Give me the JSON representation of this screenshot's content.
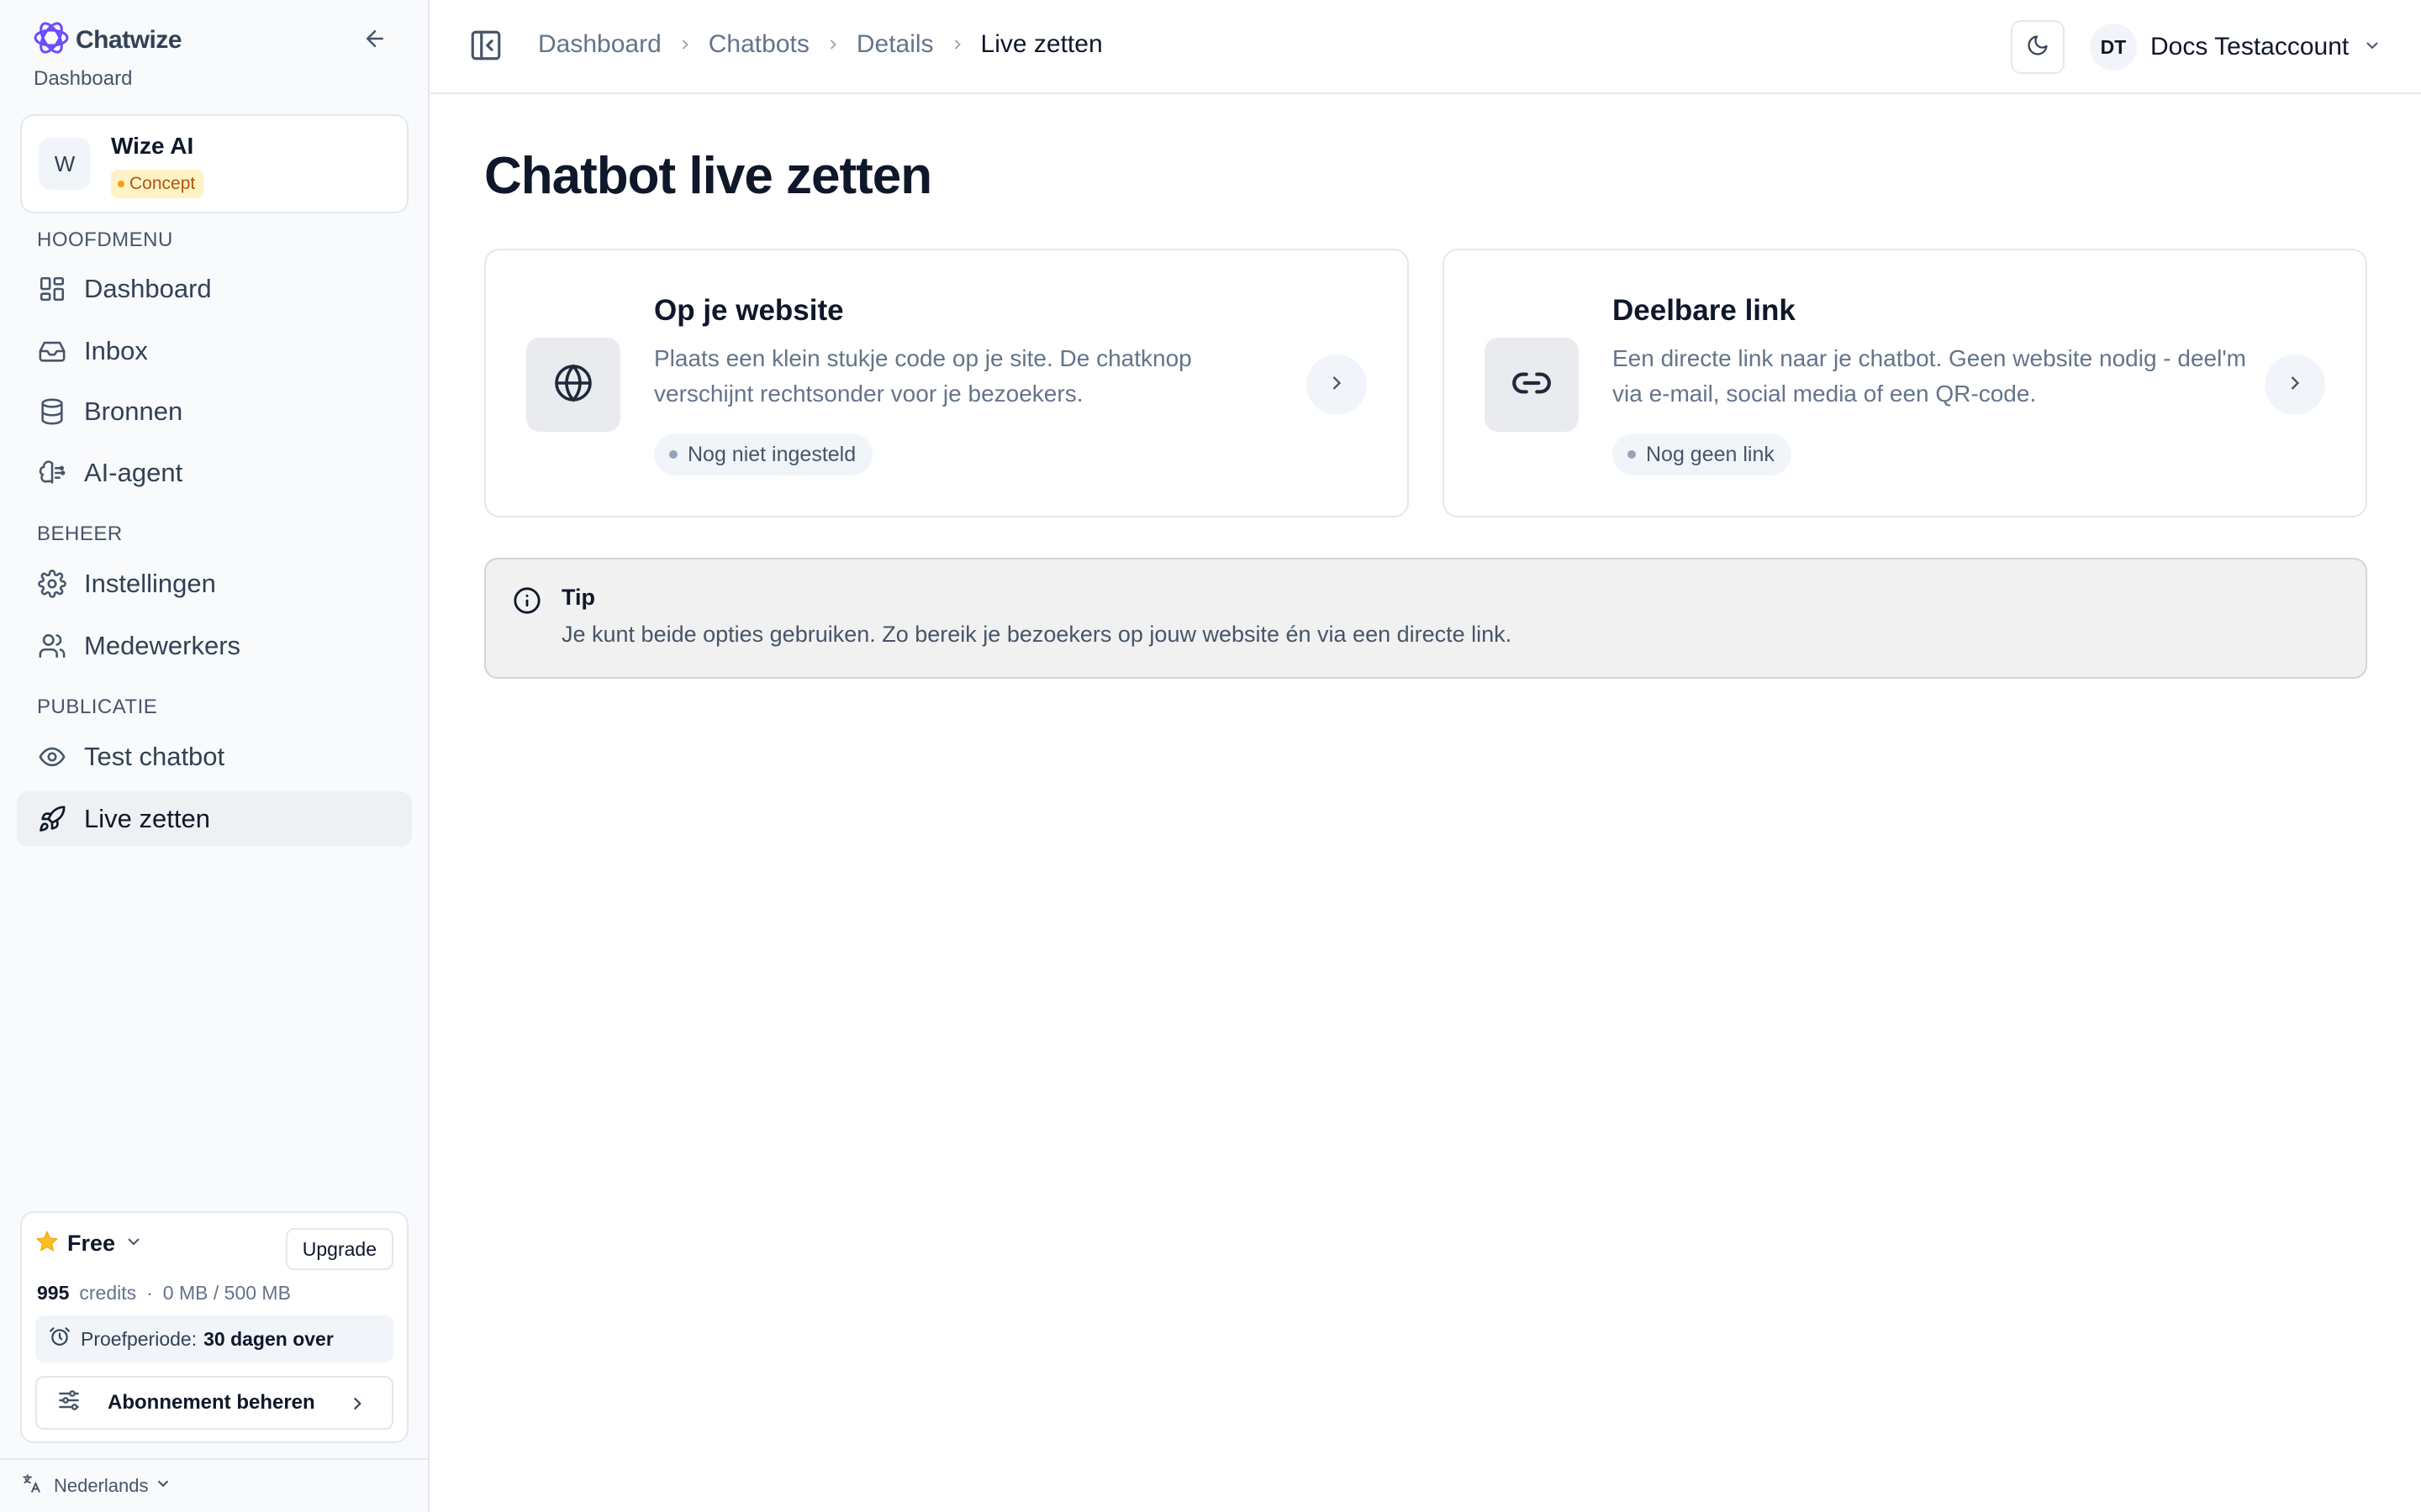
{
  "colors": {
    "brand": "#6d4aff",
    "concept": "#f59e0b",
    "star": "#fbbf24"
  },
  "sidebar": {
    "brand": "Chatwize",
    "subtitle": "Dashboard",
    "bot": {
      "initial": "W",
      "name": "Wize AI",
      "status": "Concept"
    },
    "sections": [
      {
        "label": "HOOFDMENU",
        "items": [
          {
            "label": "Dashboard",
            "icon": "layout-grid-icon"
          },
          {
            "label": "Inbox",
            "icon": "inbox-icon"
          },
          {
            "label": "Bronnen",
            "icon": "database-icon"
          },
          {
            "label": "AI-agent",
            "icon": "brain-icon"
          }
        ]
      },
      {
        "label": "BEHEER",
        "items": [
          {
            "label": "Instellingen",
            "icon": "gear-icon"
          },
          {
            "label": "Medewerkers",
            "icon": "users-icon"
          }
        ]
      },
      {
        "label": "PUBLICATIE",
        "items": [
          {
            "label": "Test chatbot",
            "icon": "eye-icon"
          },
          {
            "label": "Live zetten",
            "icon": "rocket-icon",
            "active": true
          }
        ]
      }
    ],
    "plan": {
      "name": "Free",
      "upgrade_label": "Upgrade",
      "credits_value": "995",
      "credits_label": "credits",
      "separator": "·",
      "storage": "0 MB / 500 MB",
      "trial_prefix": "Proefperiode:",
      "trial_value": "30 dagen over",
      "manage_label": "Abonnement beheren"
    },
    "language": "Nederlands"
  },
  "topbar": {
    "breadcrumb": [
      "Dashboard",
      "Chatbots",
      "Details",
      "Live zetten"
    ],
    "user": {
      "initials": "DT",
      "name": "Docs Testaccount"
    }
  },
  "main": {
    "title": "Chatbot live zetten",
    "options": [
      {
        "title": "Op je website",
        "description": "Plaats een klein stukje code op je site. De chatknop verschijnt rechtsonder voor je bezoekers.",
        "status": "Nog niet ingesteld",
        "icon": "globe-icon"
      },
      {
        "title": "Deelbare link",
        "description": "Een directe link naar je chatbot. Geen website nodig - deel'm via e-mail, social media of een QR-code.",
        "status": "Nog geen link",
        "icon": "link-icon"
      }
    ],
    "tip": {
      "title": "Tip",
      "text": "Je kunt beide opties gebruiken. Zo bereik je bezoekers op jouw website én via een directe link."
    }
  }
}
